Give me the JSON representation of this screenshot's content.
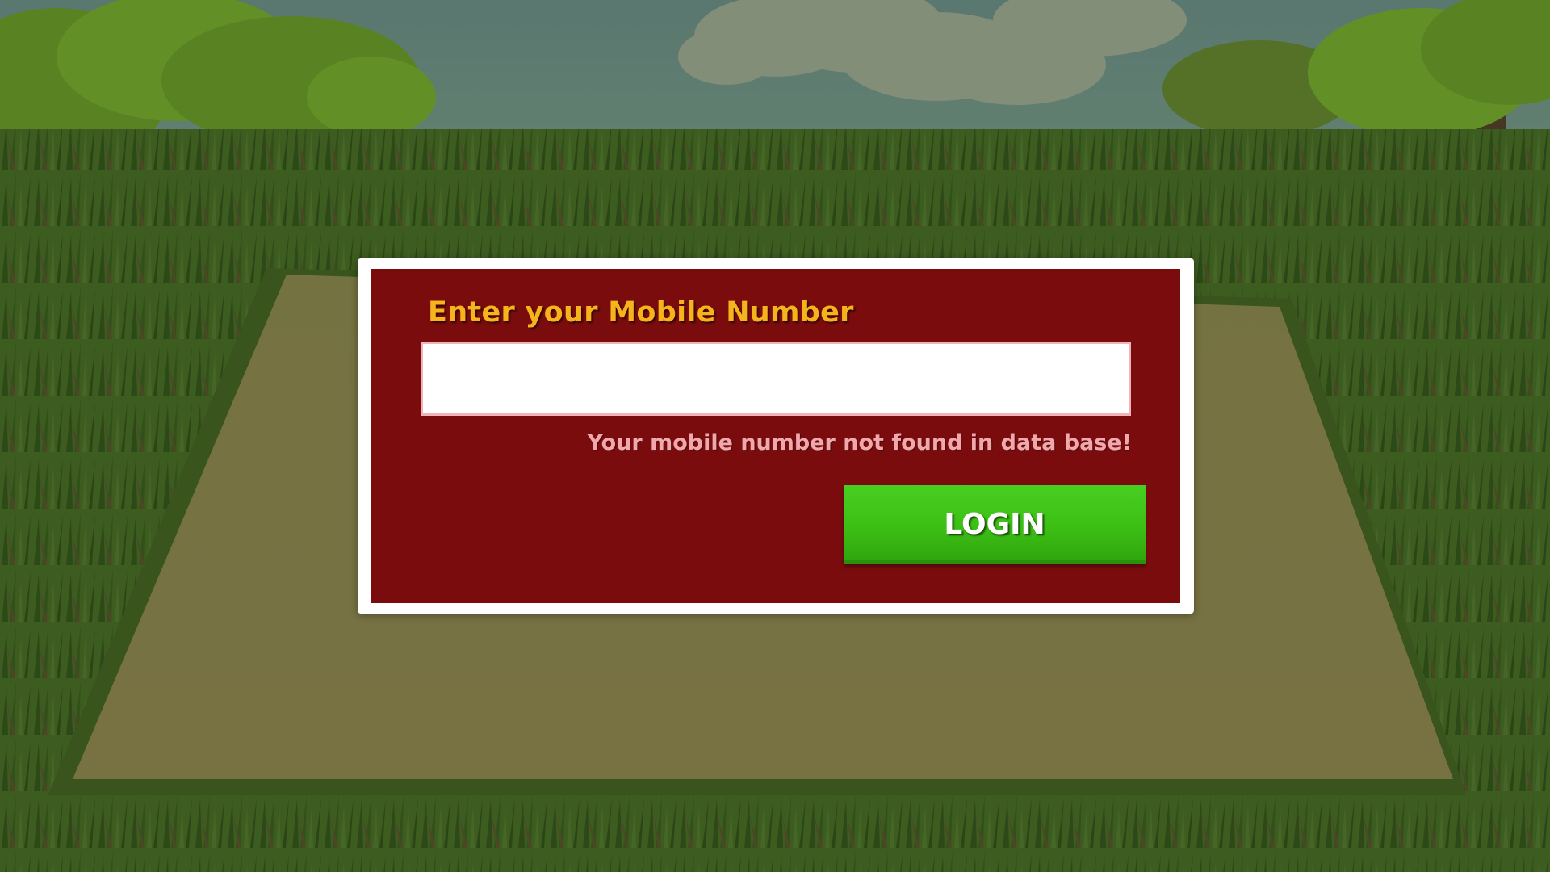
{
  "login_dialog": {
    "label": "Enter your Mobile Number",
    "mobile_input": {
      "value": "",
      "placeholder": ""
    },
    "error_message": "Your mobile number not found in data base!",
    "login_label": "LOGIN"
  },
  "colors": {
    "panel": "#7a0c0e",
    "frame": "#ffffff",
    "label": "#f5b41b",
    "error": "#f0a8ad",
    "button": "#3cbf14",
    "input_border": "#f1b3b6"
  }
}
